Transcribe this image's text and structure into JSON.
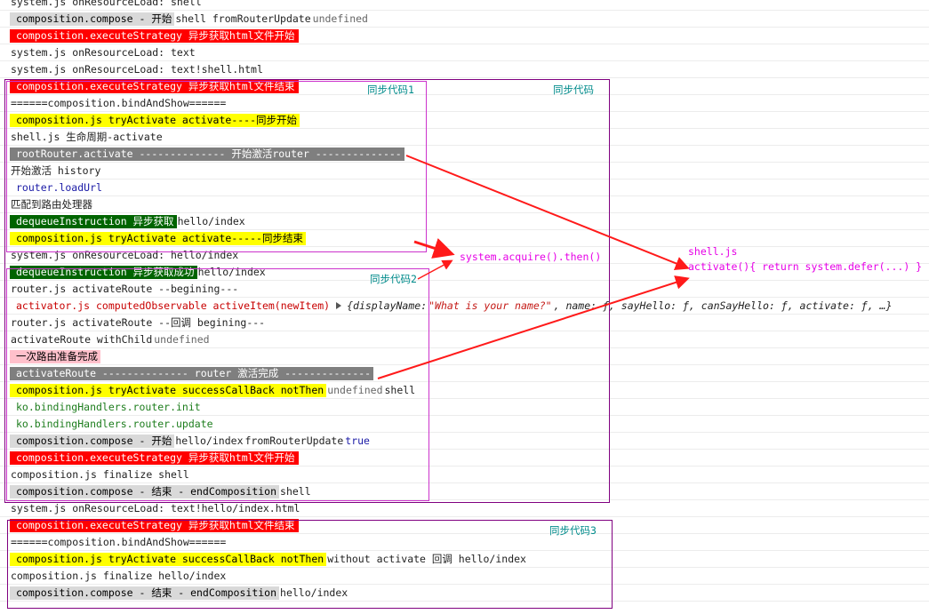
{
  "rows": [
    {
      "segs": [
        {
          "t": "system.js onResourceLoad:  shell",
          "c": "plain"
        }
      ]
    },
    {
      "segs": [
        {
          "t": "composition.compose - 开始",
          "c": "hl-gray"
        },
        {
          "t": " shell fromRouterUpdate ",
          "c": "plain"
        },
        {
          "t": "undefined",
          "c": "gray"
        }
      ]
    },
    {
      "segs": [
        {
          "t": "composition.executeStrategy 异步获取html文件开始",
          "c": "hl-red"
        }
      ]
    },
    {
      "segs": [
        {
          "t": "system.js onResourceLoad:  text",
          "c": "plain"
        }
      ]
    },
    {
      "segs": [
        {
          "t": "system.js onResourceLoad:  text!shell.html",
          "c": "plain"
        }
      ]
    },
    {
      "segs": [
        {
          "t": "composition.executeStrategy 异步获取html文件结束",
          "c": "hl-red"
        }
      ]
    },
    {
      "segs": [
        {
          "t": "======composition.bindAndShow======",
          "c": "plain"
        }
      ]
    },
    {
      "segs": [
        {
          "t": "composition.js tryActivate activate----同步开始",
          "c": "hl-yellow"
        }
      ]
    },
    {
      "segs": [
        {
          "t": "shell.js 生命周期-activate",
          "c": "plain"
        }
      ]
    },
    {
      "segs": [
        {
          "t": "rootRouter.activate -------------- 开始激活router --------------",
          "c": "hl-dgray"
        }
      ]
    },
    {
      "segs": [
        {
          "t": "开始激活 history",
          "c": "plain"
        }
      ]
    },
    {
      "segs": [
        {
          "t": "router.loadUrl",
          "c": "bluelink"
        }
      ]
    },
    {
      "segs": [
        {
          "t": "匹配到路由处理器",
          "c": "plain"
        }
      ]
    },
    {
      "segs": [
        {
          "t": "dequeueInstruction 异步获取",
          "c": "hl-green"
        },
        {
          "t": " hello/index",
          "c": "plain"
        }
      ]
    },
    {
      "segs": [
        {
          "t": "composition.js tryActivate activate-----同步结束",
          "c": "hl-yellow"
        }
      ]
    },
    {
      "segs": [
        {
          "t": "system.js onResourceLoad:  hello/index",
          "c": "plain"
        }
      ]
    },
    {
      "segs": [
        {
          "t": "dequeueInstruction 异步获取成功",
          "c": "hl-green"
        },
        {
          "t": " hello/index",
          "c": "plain"
        }
      ]
    },
    {
      "segs": [
        {
          "t": "router.js activateRoute --begining---",
          "c": "plain"
        }
      ]
    },
    {
      "segs": [
        {
          "t": "activator.js computedObservable activeItem(newItem)",
          "c": "red"
        },
        {
          "t": "",
          "c": "tri"
        },
        {
          "t": "{displayName: ",
          "c": "it"
        },
        {
          "t": "\"What is your name?\"",
          "c": "str"
        },
        {
          "t": ", name: ƒ, sayHello: ƒ, canSayHello: ƒ, activate: ƒ, …}",
          "c": "it"
        }
      ]
    },
    {
      "segs": [
        {
          "t": "router.js activateRoute --回调 begining---",
          "c": "plain"
        }
      ]
    },
    {
      "segs": [
        {
          "t": "activateRoute withChild ",
          "c": "plain"
        },
        {
          "t": "undefined",
          "c": "gray"
        }
      ]
    },
    {
      "segs": [
        {
          "t": "一次路由准备完成",
          "c": "hl-pink"
        }
      ]
    },
    {
      "segs": [
        {
          "t": "activateRoute -------------- router 激活完成 --------------",
          "c": "hl-dgray"
        }
      ]
    },
    {
      "segs": [
        {
          "t": "composition.js tryActivate successCallBack notThen",
          "c": "hl-yellow"
        },
        {
          "t": " undefined",
          "c": "gray"
        },
        {
          "t": " shell",
          "c": "plain"
        }
      ]
    },
    {
      "segs": [
        {
          "t": "ko.bindingHandlers.router.init",
          "c": "green"
        }
      ]
    },
    {
      "segs": [
        {
          "t": "ko.bindingHandlers.router.update",
          "c": "green"
        }
      ]
    },
    {
      "segs": [
        {
          "t": "composition.compose - 开始",
          "c": "hl-gray"
        },
        {
          "t": " hello/index ",
          "c": "plain"
        },
        {
          "t": "fromRouterUpdate ",
          "c": "plain"
        },
        {
          "t": "true",
          "c": "blue"
        }
      ]
    },
    {
      "segs": [
        {
          "t": "composition.executeStrategy 异步获取html文件开始",
          "c": "hl-red"
        }
      ]
    },
    {
      "segs": [
        {
          "t": "composition.js finalize shell",
          "c": "plain"
        }
      ]
    },
    {
      "segs": [
        {
          "t": "composition.compose - 结束 - endComposition",
          "c": "hl-gray"
        },
        {
          "t": " shell",
          "c": "plain"
        }
      ]
    },
    {
      "segs": [
        {
          "t": "system.js onResourceLoad:  text!hello/index.html",
          "c": "plain"
        }
      ]
    },
    {
      "segs": [
        {
          "t": "composition.executeStrategy 异步获取html文件结束",
          "c": "hl-red"
        }
      ]
    },
    {
      "segs": [
        {
          "t": "======composition.bindAndShow======",
          "c": "plain"
        }
      ]
    },
    {
      "segs": [
        {
          "t": "composition.js tryActivate successCallBack notThen",
          "c": "hl-yellow"
        },
        {
          "t": " without activate 回调 hello/index",
          "c": "plain"
        }
      ]
    },
    {
      "segs": [
        {
          "t": "composition.js finalize hello/index",
          "c": "plain"
        }
      ]
    },
    {
      "segs": [
        {
          "t": "composition.compose - 结束 - endComposition",
          "c": "hl-gray"
        },
        {
          "t": " hello/index",
          "c": "plain"
        }
      ]
    }
  ],
  "box_labels": {
    "sync1": "同步代码1",
    "sync_outer": "同步代码",
    "sync2": "同步代码2",
    "sync3": "同步代码3"
  },
  "notes": {
    "acquire": "system.acquire().then()",
    "shell_file": "shell.js",
    "shell_activate": "activate(){ return system.defer(...) }"
  },
  "colors": {
    "highlight_red": "#ff0000",
    "highlight_yellow": "#ffff00",
    "highlight_gray": "#d9d9d9",
    "highlight_darkgray": "#7f7f7f",
    "highlight_green": "#006400",
    "highlight_pink": "#ffc0cb",
    "box_border": "#a020a0",
    "label_teal": "#008b8b",
    "note_magenta": "#e600e6",
    "arrow_red": "#ff1a1a"
  }
}
